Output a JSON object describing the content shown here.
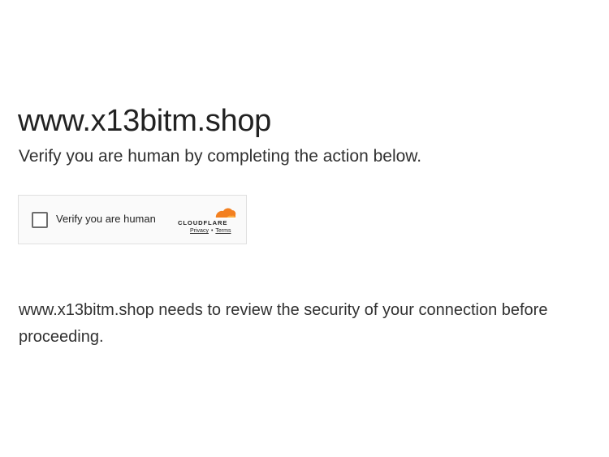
{
  "page": {
    "site_title": "www.x13bitm.shop",
    "subtitle": "Verify you are human by completing the action below.",
    "body_text": "www.x13bitm.shop needs to review the security of your connection before proceeding."
  },
  "challenge_widget": {
    "checkbox_label": "Verify you are human",
    "checkbox_checked": false,
    "brand": "CLOUDFLARE",
    "privacy_link": "Privacy",
    "separator": "•",
    "terms_link": "Terms",
    "brand_color": "#f38020",
    "brand_color_light": "#fbad41"
  }
}
